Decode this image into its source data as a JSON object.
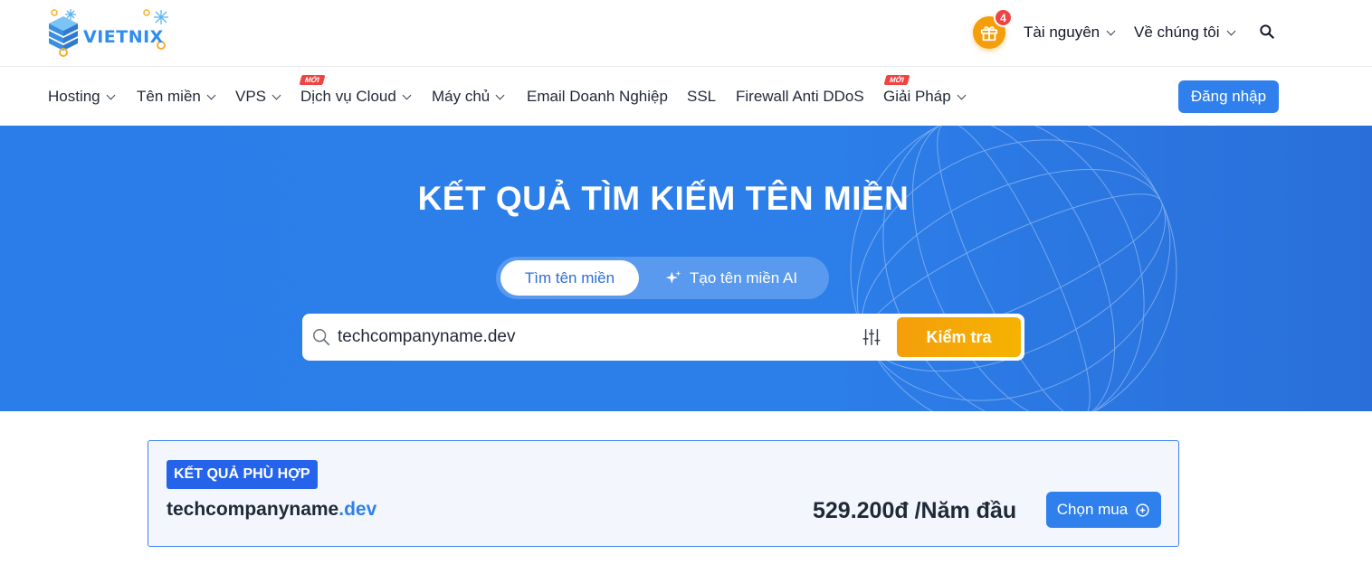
{
  "header": {
    "logo_text": "VIETNIX",
    "gift_count": "4",
    "links": [
      {
        "label": "Tài nguyên"
      },
      {
        "label": "Về chúng tôi"
      }
    ]
  },
  "nav": {
    "items": [
      {
        "label": "Hosting",
        "dropdown": true
      },
      {
        "label": "Tên miền",
        "dropdown": true
      },
      {
        "label": "VPS",
        "dropdown": true
      },
      {
        "label": "Dịch vụ Cloud",
        "dropdown": true,
        "tag": "MỚI"
      },
      {
        "label": "Máy chủ",
        "dropdown": true
      },
      {
        "label": "Email Doanh Nghiệp",
        "dropdown": false
      },
      {
        "label": "SSL",
        "dropdown": false
      },
      {
        "label": "Firewall Anti DDoS",
        "dropdown": false
      },
      {
        "label": "Giải Pháp",
        "dropdown": true,
        "tag": "MỚI"
      }
    ],
    "login_label": "Đăng nhập"
  },
  "hero": {
    "title": "KẾT QUẢ TÌM KIẾM TÊN MIỀN",
    "tab_search": "Tìm tên miền",
    "tab_ai": "Tạo tên miền AI",
    "search_value": "techcompanyname.dev",
    "check_label": "Kiểm tra"
  },
  "result": {
    "badge": "KẾT QUẢ PHÙ HỢP",
    "domain_name": "techcompanyname",
    "domain_tld": ".dev",
    "price": "529.200đ /Năm đầu",
    "buy_label": "Chọn mua"
  },
  "colors": {
    "primary": "#2f80ed",
    "accent": "#f59e0b",
    "badge_red": "#ef4444"
  }
}
